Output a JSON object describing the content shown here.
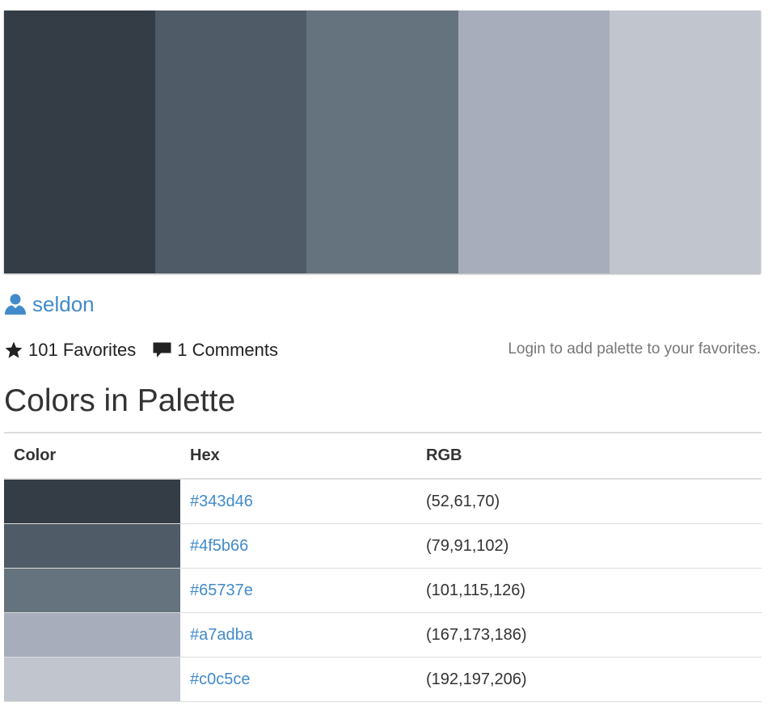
{
  "palette": {
    "colors": [
      "#343d46",
      "#4f5b66",
      "#65737e",
      "#a7adba",
      "#c0c5ce"
    ]
  },
  "author": {
    "name": "seldon",
    "icon": "user-icon"
  },
  "stats": {
    "favorites": "101 Favorites",
    "comments": "1 Comments",
    "favorites_icon": "star-icon",
    "comments_icon": "comment-icon"
  },
  "login_note": "Login to add palette to your favorites.",
  "section_title": "Colors in Palette",
  "table": {
    "headers": [
      "Color",
      "Hex",
      "RGB"
    ],
    "rows": [
      {
        "color": "#343d46",
        "hex": "#343d46",
        "rgb": "(52,61,70)"
      },
      {
        "color": "#4f5b66",
        "hex": "#4f5b66",
        "rgb": "(79,91,102)"
      },
      {
        "color": "#65737e",
        "hex": "#65737e",
        "rgb": "(101,115,126)"
      },
      {
        "color": "#a7adba",
        "hex": "#a7adba",
        "rgb": "(167,173,186)"
      },
      {
        "color": "#c0c5ce",
        "hex": "#c0c5ce",
        "rgb": "(192,197,206)"
      }
    ]
  }
}
